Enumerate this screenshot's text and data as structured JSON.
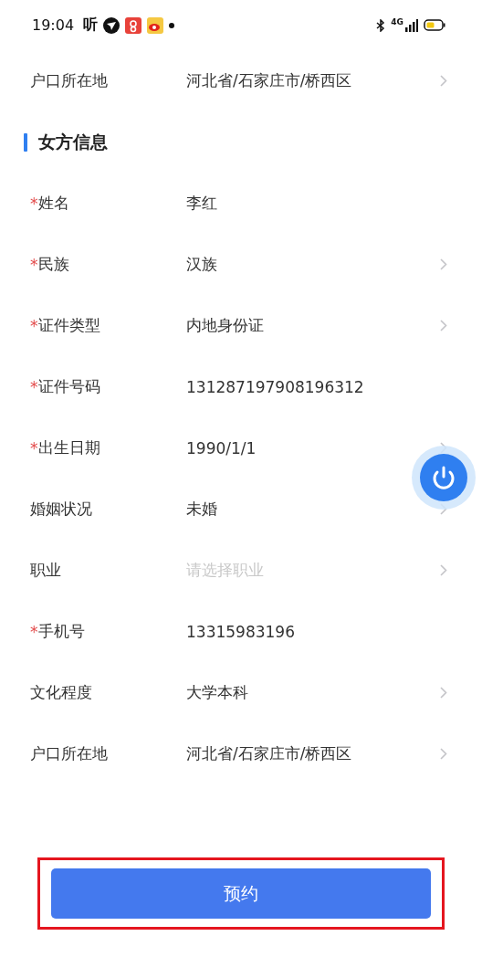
{
  "status_bar": {
    "time": "19:04",
    "app_glyph": "听",
    "network": "4G"
  },
  "top_row": {
    "label": "户口所在地",
    "value": "河北省/石家庄市/桥西区",
    "chevron": true
  },
  "section": {
    "title": "女方信息"
  },
  "rows": [
    {
      "required_mark": "*",
      "label": "姓名",
      "value": "李红",
      "chevron": false
    },
    {
      "required_mark": "*",
      "label": "民族",
      "value": "汉族",
      "chevron": true
    },
    {
      "required_mark": "*",
      "label": "证件类型",
      "value": "内地身份证",
      "chevron": true
    },
    {
      "required_mark": "*",
      "label": "证件号码",
      "value": "131287197908196312",
      "chevron": false
    },
    {
      "required_mark": "*",
      "label": "出生日期",
      "value": "1990/1/1",
      "chevron": true
    },
    {
      "label": "婚姻状况",
      "value": "未婚",
      "chevron": true
    },
    {
      "label": "职业",
      "placeholder": "请选择职业",
      "chevron": true
    },
    {
      "required_mark": "*",
      "label": "手机号",
      "value": "13315983196",
      "chevron": false
    },
    {
      "label": "文化程度",
      "value": "大学本科",
      "chevron": true
    },
    {
      "label": "户口所在地",
      "value": "河北省/石家庄市/桥西区",
      "chevron": true
    }
  ],
  "submit": {
    "label": "预约",
    "highlighted": true
  }
}
